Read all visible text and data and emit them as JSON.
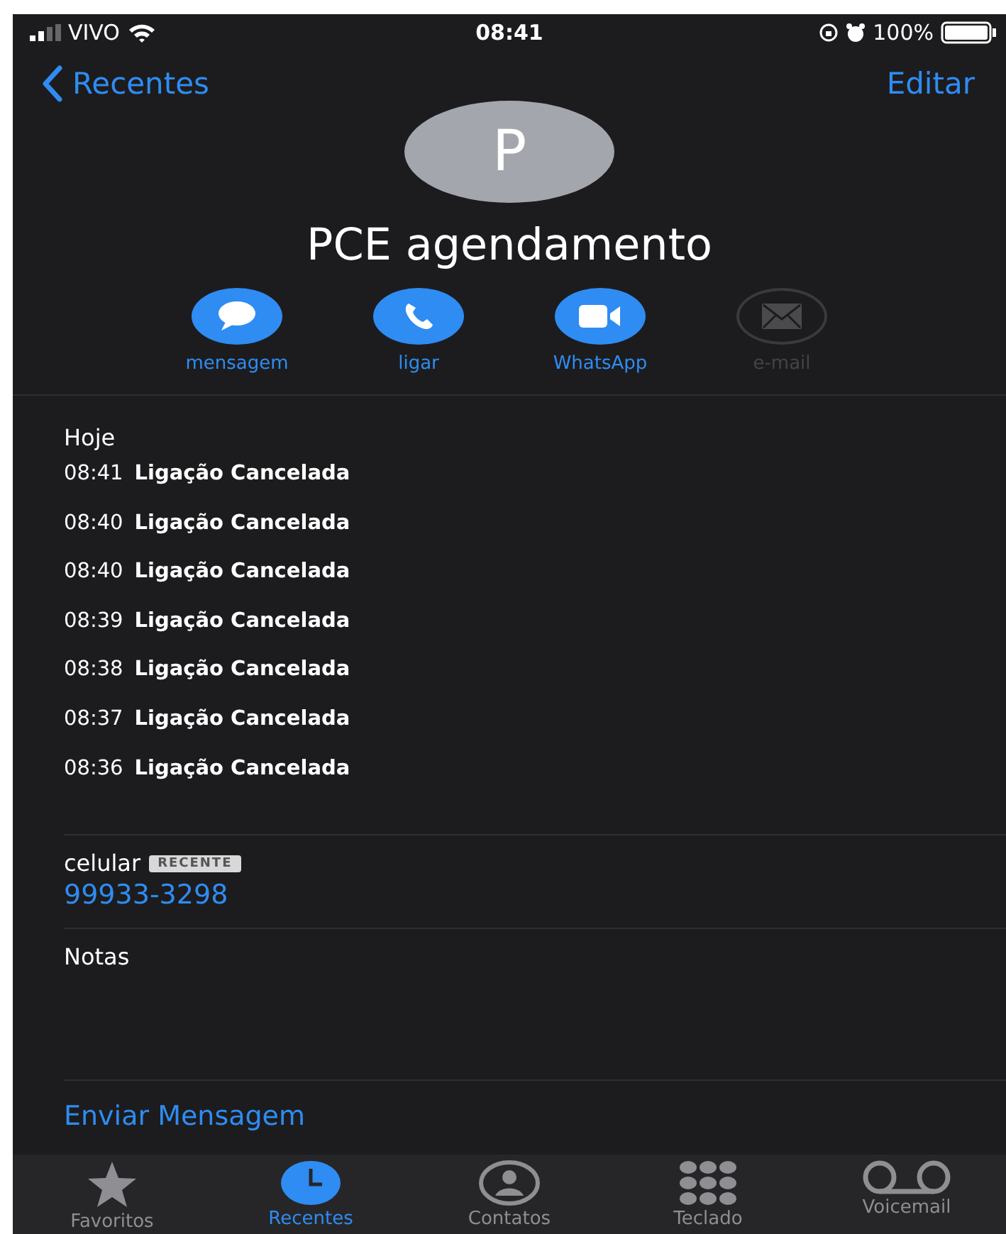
{
  "status_bar": {
    "carrier": "VIVO",
    "time": "08:41",
    "battery": "100%"
  },
  "nav": {
    "back": "Recentes",
    "action": "Editar"
  },
  "contact": {
    "initial": "P",
    "name": "PCE agendamento"
  },
  "actions": [
    {
      "kind": "message",
      "label": "mensagem",
      "disabled": false
    },
    {
      "kind": "phone",
      "label": "ligar",
      "disabled": false
    },
    {
      "kind": "video",
      "label": "WhatsApp",
      "disabled": false
    },
    {
      "kind": "mail",
      "label": "e-mail",
      "disabled": true
    }
  ],
  "calls": {
    "day": "Hoje",
    "items": [
      {
        "time": "08:41",
        "text": "Ligação Cancelada"
      },
      {
        "time": "08:40",
        "text": "Ligação Cancelada"
      },
      {
        "time": "08:40",
        "text": "Ligação Cancelada"
      },
      {
        "time": "08:39",
        "text": "Ligação Cancelada"
      },
      {
        "time": "08:38",
        "text": "Ligação Cancelada"
      },
      {
        "time": "08:37",
        "text": "Ligação Cancelada"
      },
      {
        "time": "08:36",
        "text": "Ligação Cancelada"
      }
    ]
  },
  "phone": {
    "label": "celular",
    "badge": "RECENTE",
    "number": "99933-3298"
  },
  "notes": {
    "label": "Notas"
  },
  "send_message": "Enviar Mensagem",
  "tab_bar": [
    {
      "kind": "star",
      "label": "Favoritos",
      "selected": false
    },
    {
      "kind": "clock",
      "label": "Recentes",
      "selected": true
    },
    {
      "kind": "person",
      "label": "Contatos",
      "selected": false
    },
    {
      "kind": "keypad",
      "label": "Teclado",
      "selected": false
    },
    {
      "kind": "voicemail",
      "label": "Voicemail",
      "selected": false
    }
  ]
}
